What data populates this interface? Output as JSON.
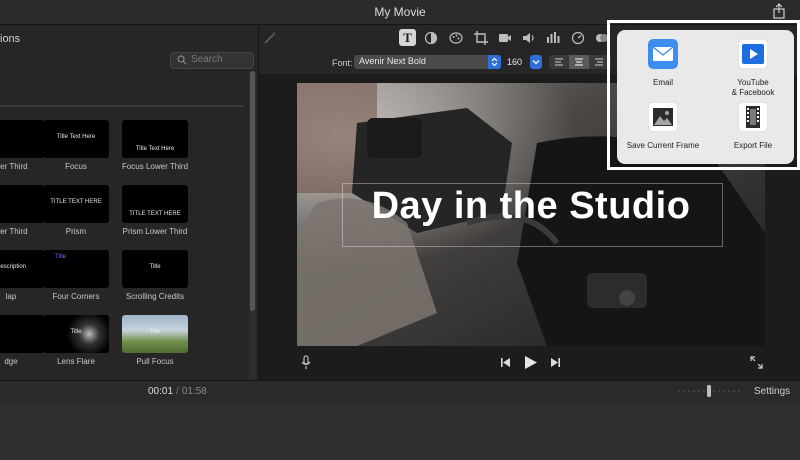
{
  "window": {
    "title": "My Movie"
  },
  "browser": {
    "tab_label": "ions",
    "search_placeholder": "Search",
    "thumbnails": [
      {
        "label": "wer Third",
        "text": ""
      },
      {
        "label": "Focus",
        "text": "Title Text Here"
      },
      {
        "label": "Focus Lower Third",
        "text": "Title Text Here"
      },
      {
        "label": "wer Third",
        "text": ""
      },
      {
        "label": "Prism",
        "text": "TITLE TEXT HERE"
      },
      {
        "label": "Prism Lower Third",
        "text": "TITLE TEXT HERE"
      },
      {
        "label": "lap",
        "text": "Description"
      },
      {
        "label": "Four Corners",
        "text": "Title"
      },
      {
        "label": "Scrolling Credits",
        "text": "Title"
      },
      {
        "label": "dge",
        "text": ""
      },
      {
        "label": "Lens Flare",
        "text": "Title"
      },
      {
        "label": "Pull Focus",
        "text": "Title"
      }
    ]
  },
  "format_bar": {
    "font_label": "Font:",
    "font_value": "Avenir Next Bold",
    "size_value": "160"
  },
  "viewer": {
    "title_text": "Day in the Studio"
  },
  "timebar": {
    "current": "00:01",
    "separator": "/",
    "total": "01:58",
    "settings_label": "Settings"
  },
  "share_menu": {
    "items": [
      {
        "label": "Email",
        "icon": "mail-icon"
      },
      {
        "label": "YouTube\n& Facebook",
        "icon": "youtube-facebook-icon"
      },
      {
        "label": "Save Current Frame",
        "icon": "save-frame-icon"
      },
      {
        "label": "Export File",
        "icon": "export-file-icon"
      }
    ]
  },
  "colors": {
    "accent": "#2f6fd8",
    "highlight_border": "#ffffff",
    "popover_bg": "#e9e9e9"
  }
}
